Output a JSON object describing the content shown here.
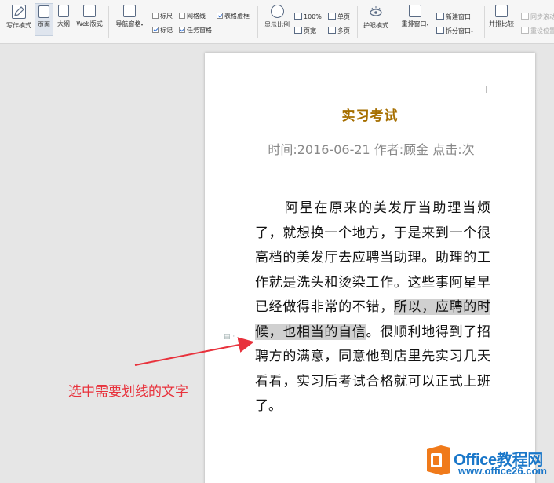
{
  "ribbon": {
    "write_mode": "写作模式",
    "page_view": "页面",
    "outline": "大纲",
    "web_layout": "Web版式",
    "nav_pane": "导航窗格",
    "ruler": "标尺",
    "gridlines": "网格线",
    "table_gridlines": "表格虚框",
    "mark": "标记",
    "task_pane": "任务窗格",
    "zoom_display": "显示比例",
    "zoom_100": "100%",
    "single_page": "单页",
    "page_width": "页宽",
    "multi_page": "多页",
    "eye_protect": "护眼模式",
    "arrange_windows": "重排窗口",
    "new_window": "新建窗口",
    "split_window": "拆分窗口",
    "side_by_side": "并排比较",
    "sync_scroll": "同步滚动",
    "reset_position": "重设位置",
    "checks": {
      "ruler": false,
      "gridlines": false,
      "table_gridlines": true,
      "mark": true,
      "task_pane": true
    }
  },
  "document": {
    "title": "实习考试",
    "meta": "时间:2016-06-21  作者:顾金  点击:次",
    "body_before": "　　阿星在原来的美发厅当助理当烦了，就想换一个地方，于是来到一个很高档的美发厅去应聘当助理。助理的工作就是洗头和烫染工作。这些事阿星早已经做得非常的不错，",
    "body_selected": "所以，应聘的时候，也相当的自信",
    "body_after": "。很顺利地得到了招聘方的满意，同意他到店里先实习几天看看，实习后考试合格就可以正式上班了。"
  },
  "annotation": {
    "text": "选中需要划线的文字",
    "color": "#e8323c"
  },
  "watermark": {
    "brand": "Office教程网",
    "url": "www.office26.com",
    "logo_color": "#f07a1a",
    "text_color": "#1a77c9"
  }
}
